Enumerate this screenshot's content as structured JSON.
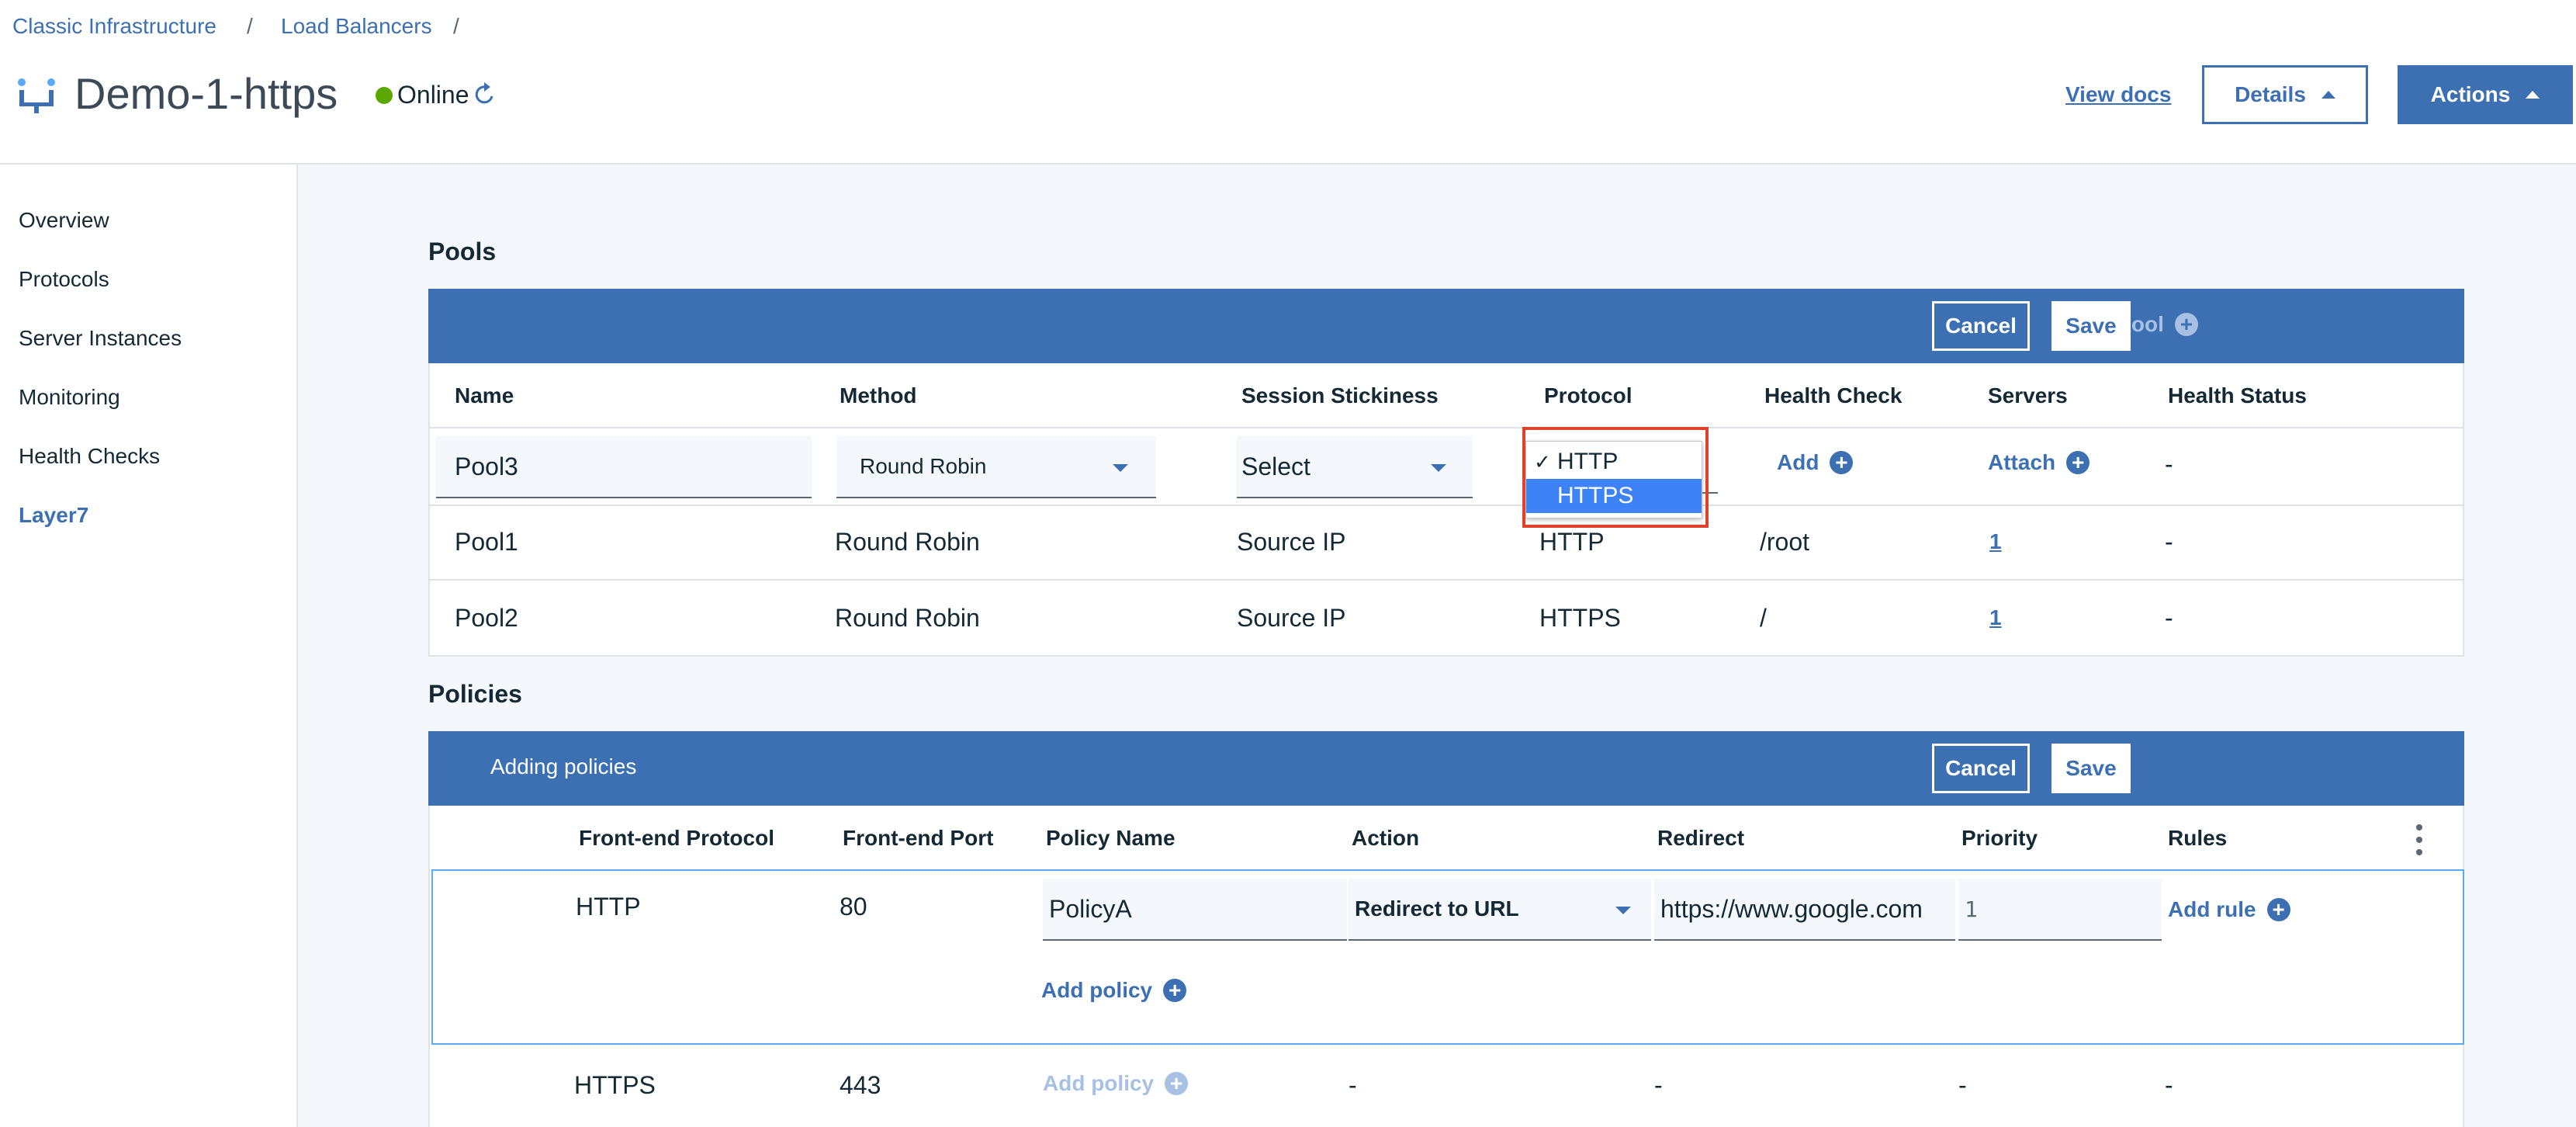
{
  "breadcrumb": {
    "item1": "Classic Infrastructure",
    "sep1": "/",
    "item2": "Load Balancers",
    "sep2": "/"
  },
  "header": {
    "title": "Demo-1-https",
    "status": "Online",
    "view_docs": "View docs",
    "details_label": "Details",
    "actions_label": "Actions"
  },
  "sidebar": {
    "items": [
      {
        "label": "Overview"
      },
      {
        "label": "Protocols"
      },
      {
        "label": "Server Instances"
      },
      {
        "label": "Monitoring"
      },
      {
        "label": "Health Checks"
      },
      {
        "label": "Layer7"
      }
    ],
    "active": "Layer7"
  },
  "pools": {
    "title": "Pools",
    "toolbar": {
      "add_pool": "Add Pool",
      "cancel": "Cancel",
      "save": "Save"
    },
    "columns": [
      "Name",
      "Method",
      "Session Stickiness",
      "Protocol",
      "Health Check",
      "Servers",
      "Health Status"
    ],
    "edit_row": {
      "name": "Pool3",
      "method": "Round Robin",
      "stickiness": "Select",
      "protocol_options": [
        "HTTP",
        "HTTPS"
      ],
      "protocol_checked": "HTTP",
      "protocol_highlighted": "HTTPS",
      "health_check_add": "Add",
      "servers_attach": "Attach",
      "health_status": "-"
    },
    "rows": [
      {
        "name": "Pool1",
        "method": "Round Robin",
        "stickiness": "Source IP",
        "protocol": "HTTP",
        "health_check": "/root",
        "servers": "1",
        "health_status": "-"
      },
      {
        "name": "Pool2",
        "method": "Round Robin",
        "stickiness": "Source IP",
        "protocol": "HTTPS",
        "health_check": "/",
        "servers": "1",
        "health_status": "-"
      }
    ]
  },
  "policies": {
    "title": "Policies",
    "toolbar": {
      "label": "Adding policies",
      "cancel": "Cancel",
      "save": "Save"
    },
    "columns": [
      "Front-end Protocol",
      "Front-end Port",
      "Policy Name",
      "Action",
      "Redirect",
      "Priority",
      "Rules"
    ],
    "edit_row": {
      "protocol": "HTTP",
      "port": "80",
      "policy_name": "PolicyA",
      "action": "Redirect to URL",
      "redirect": "https://www.google.com",
      "priority": "1",
      "add_rule": "Add rule",
      "add_policy": "Add policy"
    },
    "rows": [
      {
        "protocol": "HTTPS",
        "port": "443",
        "add_policy": "Add policy",
        "action": "-",
        "redirect": "-",
        "priority": "-",
        "rules": "-"
      }
    ]
  },
  "icons": {
    "app": "load-balancer-icon",
    "refresh": "refresh-icon"
  },
  "colors": {
    "accent": "#3d70b2",
    "online": "#5aa700",
    "highlight": "#e0412b"
  }
}
